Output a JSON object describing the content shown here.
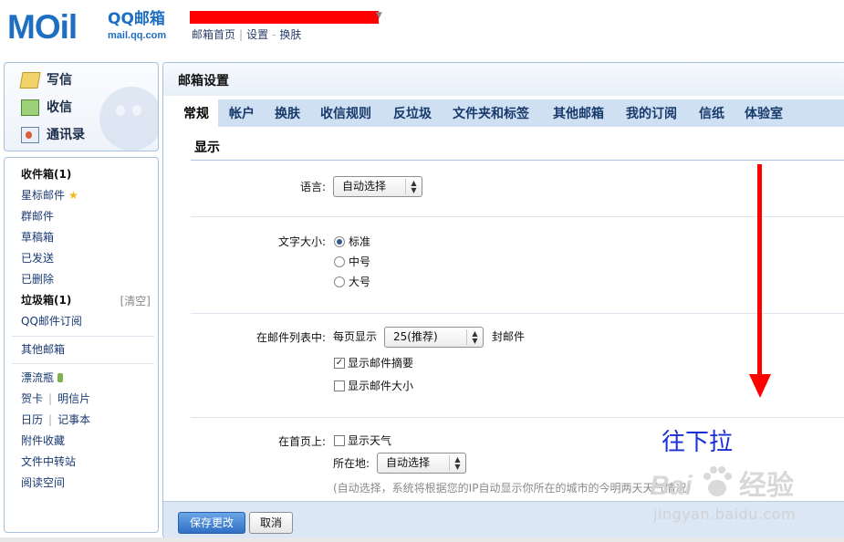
{
  "header": {
    "logo_mail": "MOil",
    "logo_qq": "QQ邮箱",
    "logo_domain": "mail.qq.com",
    "links": [
      "邮箱首页",
      "设置",
      "换肤"
    ],
    "separators": [
      "|",
      "-"
    ]
  },
  "sidebar": {
    "actions": [
      {
        "label": "写信",
        "icon": "pencil-icon"
      },
      {
        "label": "收信",
        "icon": "inbox-download-icon"
      },
      {
        "label": "通讯录",
        "icon": "contacts-card-icon"
      }
    ],
    "folders": [
      {
        "label": "收件箱(1)"
      },
      {
        "label": "星标邮件"
      },
      {
        "label": "群邮件"
      },
      {
        "label": "草稿箱"
      },
      {
        "label": "已发送"
      },
      {
        "label": "已删除"
      },
      {
        "label": "垃圾箱(1)"
      },
      {
        "label": "QQ邮件订阅"
      }
    ],
    "clear_label": "[清空]",
    "other_mailbox": "其他邮箱",
    "apps": {
      "drift_bottle": "漂流瓶",
      "greeting_card": "贺卡",
      "postcard": "明信片",
      "calendar": "日历",
      "notepad": "记事本",
      "attachments": "附件收藏",
      "file_transfer": "文件中转站",
      "reading_space": "阅读空间"
    }
  },
  "main": {
    "title": "邮箱设置",
    "tabs": [
      "常规",
      "帐户",
      "换肤",
      "收信规则",
      "反垃圾",
      "文件夹和标签",
      "其他邮箱",
      "我的订阅",
      "信纸",
      "体验室"
    ],
    "active_tab": "常规",
    "section_title": "显示",
    "language": {
      "label": "语言:",
      "value": "自动选择"
    },
    "font_size": {
      "label": "文字大小:",
      "options": [
        "标准",
        "中号",
        "大号"
      ],
      "selected": "标准"
    },
    "mail_list": {
      "label": "在邮件列表中:",
      "per_page_prefix": "每页显示",
      "per_page_value": "25(推荐)",
      "per_page_suffix": "封邮件",
      "show_summary": "显示邮件摘要",
      "show_summary_checked": true,
      "show_size": "显示邮件大小",
      "show_size_checked": false
    },
    "homepage": {
      "label": "在首页上:",
      "show_weather": "显示天气",
      "show_weather_checked": false,
      "location_label": "所在地:",
      "location_value": "自动选择",
      "hint": "(自动选择，系统将根据您的IP自动显示你所在的城市的今明两天天气情况)"
    },
    "save_button": "保存更改",
    "cancel_button": "取消"
  },
  "overlay": {
    "annotation": "往下拉",
    "arrow_color": "#ff0000",
    "watermark_brand_a": "Bai",
    "watermark_brand_b": "经验",
    "watermark_url": "jingyan.baidu.com"
  },
  "colors": {
    "brand_blue": "#1e6fc1",
    "tab_bar": "#cfe0f3",
    "save_button": "#2f6fc4",
    "redaction": "#ff0000"
  }
}
